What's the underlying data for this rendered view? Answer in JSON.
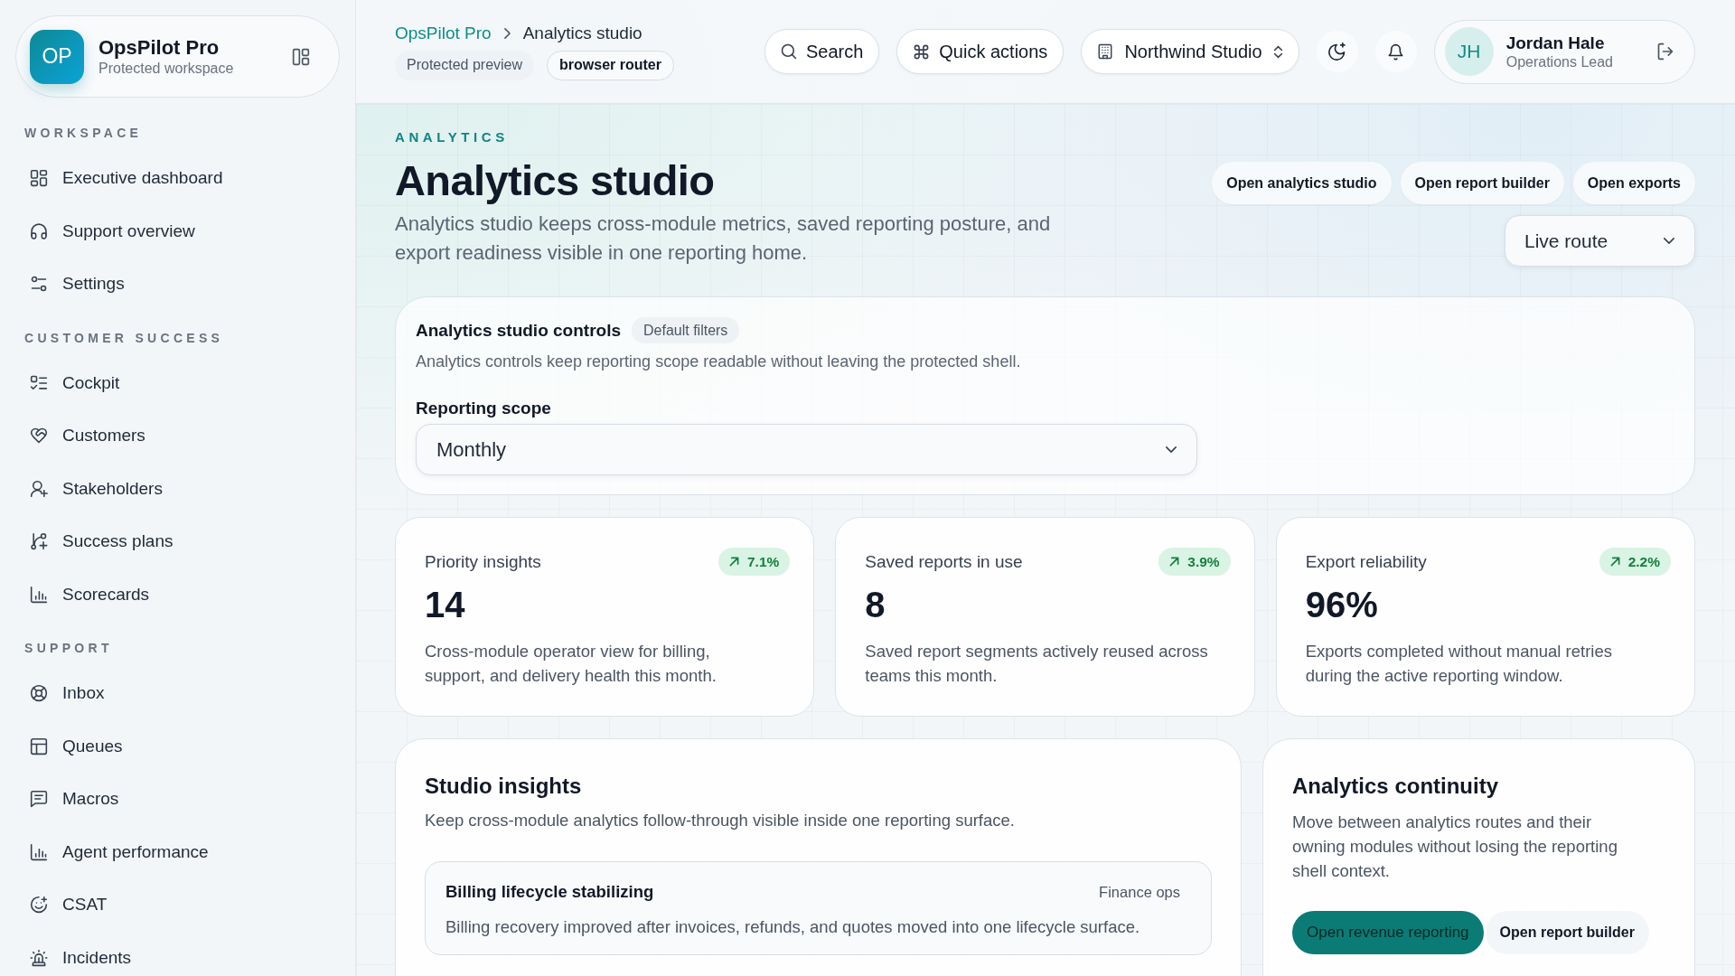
{
  "sidebar": {
    "brand": {
      "initials": "OP",
      "name": "OpsPilot Pro",
      "subtitle": "Protected workspace"
    },
    "sections": [
      {
        "label": "WORKSPACE",
        "items": [
          {
            "label": "Executive dashboard",
            "selected": false
          },
          {
            "label": "Support overview",
            "selected": false
          },
          {
            "label": "Settings",
            "selected": false
          }
        ]
      },
      {
        "label": "CUSTOMER SUCCESS",
        "items": [
          {
            "label": "Cockpit",
            "selected": false
          },
          {
            "label": "Customers",
            "selected": false
          },
          {
            "label": "Stakeholders",
            "selected": false
          },
          {
            "label": "Success plans",
            "selected": false
          },
          {
            "label": "Scorecards",
            "selected": false
          }
        ]
      },
      {
        "label": "SUPPORT",
        "items": [
          {
            "label": "Inbox",
            "selected": false
          },
          {
            "label": "Queues",
            "selected": false
          },
          {
            "label": "Macros",
            "selected": false
          },
          {
            "label": "Agent performance",
            "selected": false
          },
          {
            "label": "CSAT",
            "selected": false
          },
          {
            "label": "Incidents",
            "selected": false
          }
        ]
      }
    ]
  },
  "top_bar": {
    "breadcrumbs": [
      {
        "label": "OpsPilot Pro",
        "current": false
      },
      {
        "label": "Analytics studio",
        "current": true
      }
    ],
    "chips": [
      {
        "label": "Protected preview",
        "kind": "plain"
      },
      {
        "label": "browser router",
        "kind": "outlined"
      }
    ],
    "search_button": {
      "label": "Search"
    },
    "quick_actions_button": {
      "label": "Quick actions"
    },
    "workspace_switcher": {
      "value": "Northwind Studio"
    },
    "user": {
      "initials": "JH",
      "name": "Jordan Hale",
      "role": "Operations Lead"
    }
  },
  "page_header": {
    "eyebrow": "ANALYTICS",
    "title": "Analytics studio",
    "description": "Analytics studio keeps cross-module metrics, saved reporting posture, and export readiness visible in one reporting home.",
    "actions": [
      {
        "label": "Open analytics studio"
      },
      {
        "label": "Open report builder"
      },
      {
        "label": "Open exports"
      }
    ],
    "route_select": {
      "value": "Live route"
    }
  },
  "controls_panel": {
    "title": "Analytics studio controls",
    "badge": "Default filters",
    "description": "Analytics controls keep reporting scope readable without leaving the protected shell.",
    "fields": [
      {
        "label": "Reporting scope",
        "value": "Monthly"
      }
    ]
  },
  "metrics": [
    {
      "label": "Priority insights",
      "change": "7.1%",
      "value": "14",
      "description": "Cross-module operator view for billing, support, and delivery health this month."
    },
    {
      "label": "Saved reports in use",
      "change": "3.9%",
      "value": "8",
      "description": "Saved report segments actively reused across teams this month."
    },
    {
      "label": "Export reliability",
      "change": "2.2%",
      "value": "96%",
      "description": "Exports completed without manual retries during the active reporting window."
    }
  ],
  "insights_card": {
    "title": "Studio insights",
    "description": "Keep cross-module analytics follow-through visible inside one reporting surface.",
    "items": [
      {
        "title": "Billing lifecycle stabilizing",
        "tag": "Finance ops",
        "description": "Billing recovery improved after invoices, refunds, and quotes moved into one lifecycle surface."
      }
    ]
  },
  "continuity_card": {
    "title": "Analytics continuity",
    "description": "Move between analytics routes and their owning modules without losing the reporting shell context.",
    "actions": [
      {
        "label": "Open revenue reporting",
        "kind": "primary"
      },
      {
        "label": "Open report builder",
        "kind": "secondary"
      }
    ]
  }
}
